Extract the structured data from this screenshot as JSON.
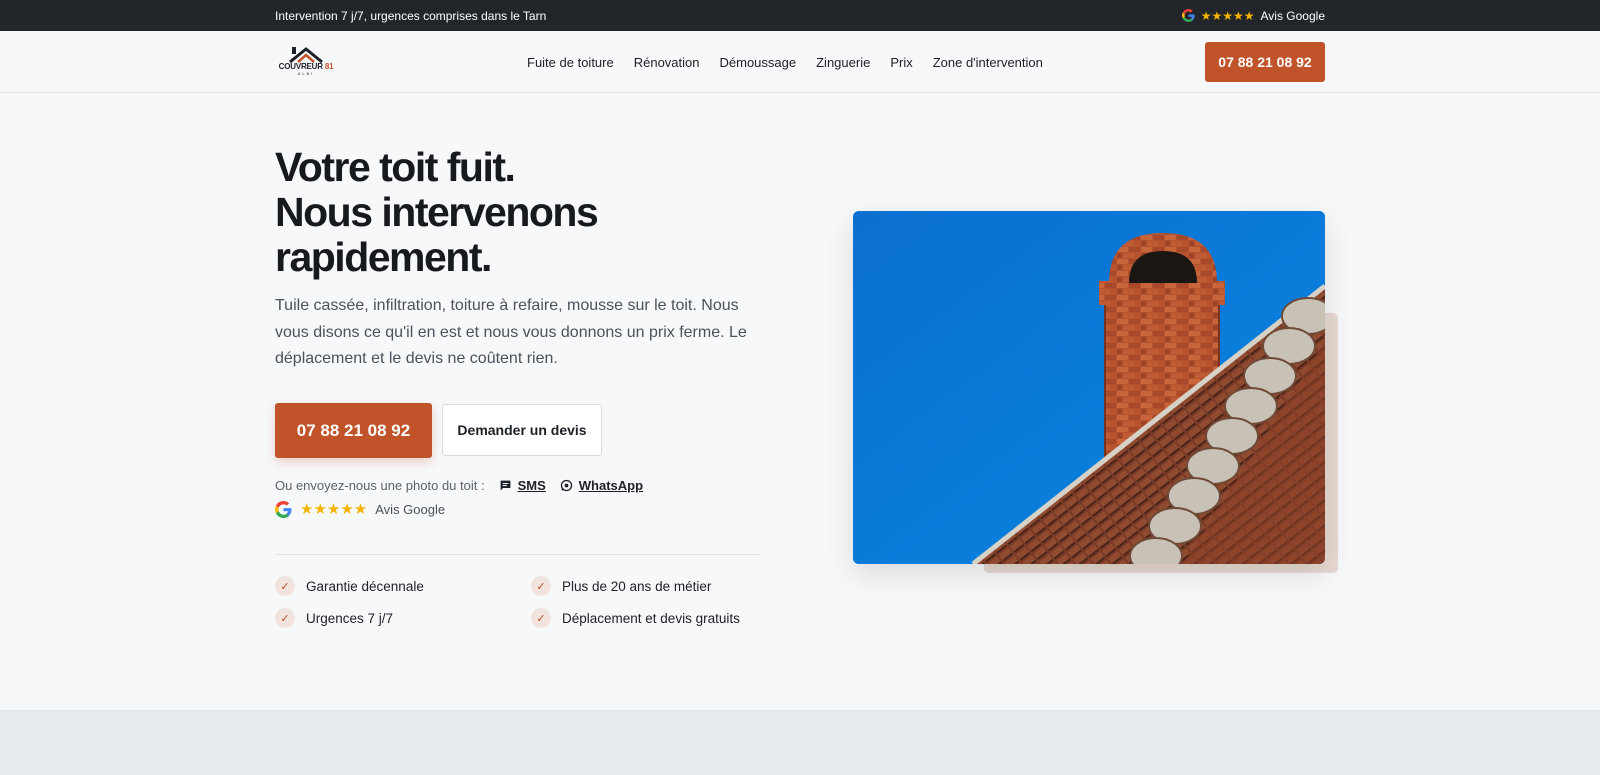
{
  "topbar": {
    "text": "Intervention 7 j/7, urgences comprises dans le Tarn",
    "rating_stars": "★★★★★",
    "rating_label": "Avis Google"
  },
  "header": {
    "logo_name": "COUVREUR",
    "logo_number": "81",
    "logo_city": "ALBI",
    "nav": [
      {
        "label": "Fuite de toiture"
      },
      {
        "label": "Rénovation"
      },
      {
        "label": "Démoussage"
      },
      {
        "label": "Zinguerie"
      },
      {
        "label": "Prix"
      },
      {
        "label": "Zone d'intervention"
      }
    ],
    "phone": "07 88 21 08 92"
  },
  "hero": {
    "title_line1": "Votre toit fuit.",
    "title_line2": "Nous intervenons",
    "title_line3": "rapidement.",
    "lead": "Tuile cassée, infiltration, toiture à refaire, mousse sur le toit. Nous vous disons ce qu'il en est et nous vous donnons un prix ferme. Le déplacement et le devis ne coûtent rien.",
    "phone_button": "07 88 21 08 92",
    "quote_button": "Demander un devis",
    "photo_prompt": "Ou envoyez-nous une photo du toit :",
    "sms_label": "SMS",
    "whatsapp_label": "WhatsApp",
    "rating_stars": "★★★★★",
    "rating_label": "Avis Google",
    "features": [
      {
        "label": "Garantie décennale"
      },
      {
        "label": "Plus de 20 ans de métier"
      },
      {
        "label": "Urgences 7 j/7"
      },
      {
        "label": "Déplacement et devis gratuits"
      }
    ]
  },
  "colors": {
    "accent": "#c0532a",
    "topbar_bg": "#22262b",
    "page_bg": "#f7f8fa",
    "star": "#f5b400"
  }
}
